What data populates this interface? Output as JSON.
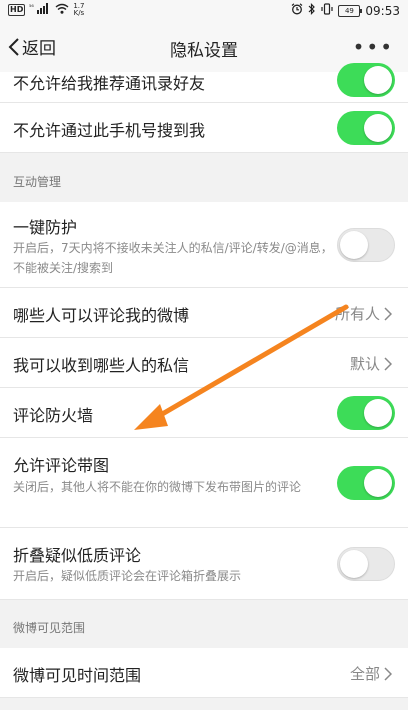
{
  "status_bar": {
    "hd": "HD",
    "signal": "⁵⁶",
    "speed_value": "1.7",
    "speed_unit": "K/s",
    "battery": "49",
    "time": "09:53"
  },
  "title_bar": {
    "back_label": "返回",
    "title": "隐私设置",
    "more": "•••"
  },
  "rows_top": [
    {
      "title": "不允许给我推荐通讯录好友",
      "toggle": "on"
    },
    {
      "title": "不允许通过此手机号搜到我",
      "toggle": "on"
    }
  ],
  "section_interaction": "互动管理",
  "one_key_protect": {
    "title": "一键防护",
    "desc": "开启后，7天内将不接收未关注人的私信/评论/转发/@消息，不能被关注/搜索到",
    "toggle": "off"
  },
  "who_comment": {
    "title": "哪些人可以评论我的微博",
    "value": "所有人"
  },
  "who_message": {
    "title": "我可以收到哪些人的私信",
    "value": "默认"
  },
  "firewall": {
    "title": "评论防火墙",
    "toggle": "on"
  },
  "allow_image": {
    "title": "允许评论带图",
    "desc": "关闭后，其他人将不能在你的微博下发布带图片的评论",
    "toggle": "on"
  },
  "fold_comments": {
    "title": "折叠疑似低质评论",
    "desc": "开启后，疑似低质评论会在评论箱折叠展示",
    "toggle": "off"
  },
  "section_visibility": "微博可见范围",
  "visible_range": {
    "title": "微博可见时间范围",
    "value": "全部"
  },
  "colors": {
    "toggle_on": "#3ddc58",
    "arrow": "#f5841f"
  }
}
